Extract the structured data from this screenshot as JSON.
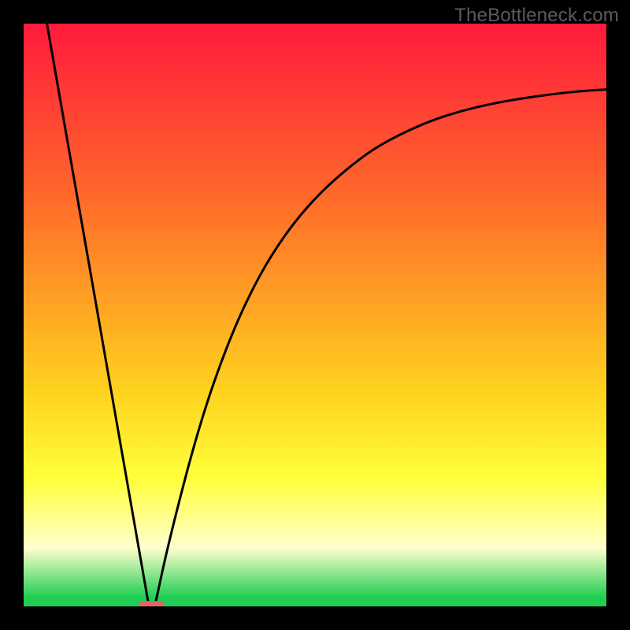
{
  "watermark": "TheBottleneck.com",
  "chart_data": {
    "type": "line",
    "title": "",
    "xlabel": "",
    "ylabel": "",
    "xlim": [
      0,
      100
    ],
    "ylim": [
      0,
      100
    ],
    "axes_visible": false,
    "grid": false,
    "legend": false,
    "background": {
      "type": "vertical-gradient",
      "stops": [
        {
          "position": 0.0,
          "color": "#ff1a3c"
        },
        {
          "position": 0.3,
          "color": "#ff6a2a"
        },
        {
          "position": 0.63,
          "color": "#ffd21f"
        },
        {
          "position": 0.78,
          "color": "#ffff3a"
        },
        {
          "position": 0.9,
          "color": "#ffffcd"
        },
        {
          "position": 0.985,
          "color": "#1fce52"
        },
        {
          "position": 1.0,
          "color": "#1fce52"
        }
      ]
    },
    "marker": {
      "x": 22,
      "y": 0,
      "width_pct": 4.5,
      "color": "#e06666"
    },
    "curve": {
      "description": "V-shaped bottleneck curve: a steep straight descent from (x≈4, y=100) to a minimum at x≈22, then a saturating rise approaching y≈90 as x→100.",
      "left_line": {
        "x0": 4.0,
        "y0": 100.0,
        "x1": 21.5,
        "y1": 0.0
      },
      "right_curve": {
        "formula": "y = A * (1 - exp(-k * (x - x_min)))",
        "A": 90.0,
        "k": 0.055,
        "x_min": 22.5
      },
      "points": [
        {
          "x": 4.0,
          "y": 100.0
        },
        {
          "x": 8.0,
          "y": 77.1
        },
        {
          "x": 12.0,
          "y": 54.3
        },
        {
          "x": 16.0,
          "y": 31.4
        },
        {
          "x": 20.0,
          "y": 8.6
        },
        {
          "x": 21.5,
          "y": 0.0
        },
        {
          "x": 22.5,
          "y": 0.0
        },
        {
          "x": 25.0,
          "y": 11.5
        },
        {
          "x": 30.0,
          "y": 30.7
        },
        {
          "x": 35.0,
          "y": 45.2
        },
        {
          "x": 40.0,
          "y": 56.1
        },
        {
          "x": 45.0,
          "y": 64.1
        },
        {
          "x": 50.0,
          "y": 70.1
        },
        {
          "x": 55.0,
          "y": 74.7
        },
        {
          "x": 60.0,
          "y": 78.5
        },
        {
          "x": 65.0,
          "y": 81.2
        },
        {
          "x": 70.0,
          "y": 83.4
        },
        {
          "x": 75.0,
          "y": 85.0
        },
        {
          "x": 80.0,
          "y": 86.2
        },
        {
          "x": 85.0,
          "y": 87.1
        },
        {
          "x": 90.0,
          "y": 87.8
        },
        {
          "x": 95.0,
          "y": 88.4
        },
        {
          "x": 100.0,
          "y": 88.7
        }
      ]
    }
  }
}
